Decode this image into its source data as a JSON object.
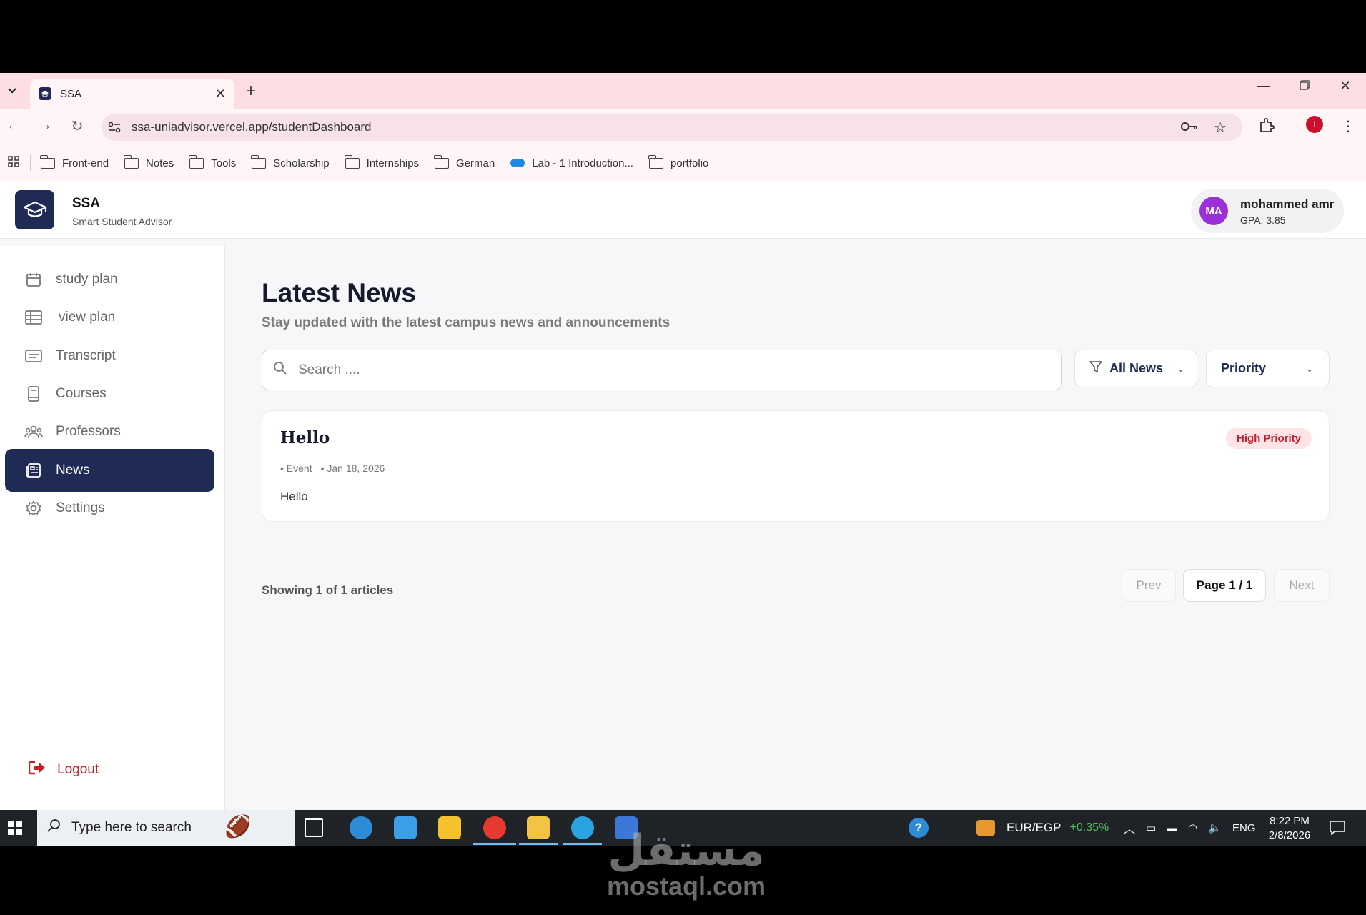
{
  "browser": {
    "tab_title": "SSA",
    "url": "ssa-uniadvisor.vercel.app/studentDashboard",
    "bookmarks": [
      "Front-end",
      "Notes",
      "Tools",
      "Scholarship",
      "Internships",
      "German",
      "Lab - 1 Introduction...",
      "portfolio"
    ],
    "profile_initial": "I"
  },
  "header": {
    "brand_name": "SSA",
    "brand_sub": "Smart Student Advisor",
    "user_initials": "MA",
    "user_name": "mohammed amr",
    "user_gpa": "GPA: 3.85"
  },
  "sidebar": {
    "items": [
      {
        "label": "study plan",
        "icon": "calendar-icon"
      },
      {
        "label": "view plan",
        "icon": "table-icon"
      },
      {
        "label": "Transcript",
        "icon": "card-icon"
      },
      {
        "label": "Courses",
        "icon": "book-icon"
      },
      {
        "label": "Professors",
        "icon": "users-icon"
      },
      {
        "label": "News",
        "icon": "newspaper-icon",
        "active": true
      },
      {
        "label": "Settings",
        "icon": "gear-icon"
      }
    ],
    "logout_label": "Logout"
  },
  "main": {
    "title": "Latest News",
    "subtitle": "Stay updated with the latest campus news and announcements",
    "search_placeholder": "Search ....",
    "filter_category": "All News",
    "filter_priority": "Priority",
    "articles": [
      {
        "title": "Hello",
        "category": "• Event",
        "date": "• Jan 18, 2026",
        "body": "Hello",
        "badge": "High Priority"
      }
    ],
    "showing": "Showing 1 of 1 articles",
    "pagination": {
      "prev": "Prev",
      "current": "Page 1 / 1",
      "next": "Next"
    }
  },
  "taskbar": {
    "search_text": "Type here to search",
    "currency": "EUR/EGP",
    "currency_change": "+0.35%",
    "language": "ENG",
    "time": "8:22 PM",
    "date": "2/8/2026"
  },
  "watermark": {
    "arabic": "مستقل",
    "latin": "mostaql.com"
  },
  "colors": {
    "primary": "#1f2b55",
    "danger": "#c81e2a",
    "tab_bar": "#fddde4",
    "avatar": "#9b30d9"
  }
}
